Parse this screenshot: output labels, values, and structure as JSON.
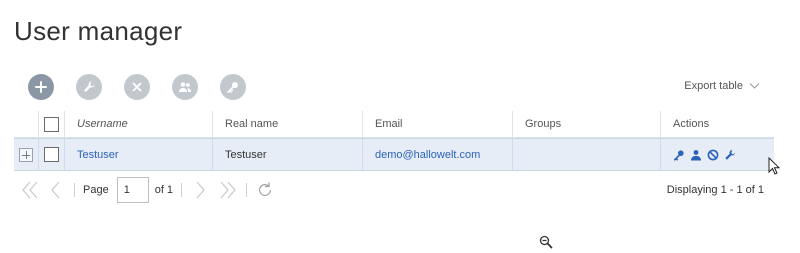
{
  "page": {
    "title": "User manager"
  },
  "toolbar": {
    "buttons": [
      {
        "name": "add-user-button",
        "icon": "plus-icon"
      },
      {
        "name": "edit-user-button",
        "icon": "wrench-icon"
      },
      {
        "name": "delete-user-button",
        "icon": "close-icon"
      },
      {
        "name": "assign-groups-button",
        "icon": "users-icon"
      },
      {
        "name": "set-password-button",
        "icon": "key-icon"
      }
    ],
    "export_label": "Export table"
  },
  "grid": {
    "columns": [
      "Username",
      "Real name",
      "Email",
      "Groups",
      "Actions"
    ],
    "rows": [
      {
        "username": "Testuser",
        "real_name": "Testuser",
        "email": "demo@hallowelt.com",
        "groups": ""
      }
    ],
    "row_actions": [
      "key-icon",
      "user-icon",
      "block-icon",
      "wrench-icon"
    ]
  },
  "pager": {
    "page_label": "Page",
    "current_page": "1",
    "of_label": "of 1",
    "displaying": "Displaying 1 - 1 of 1"
  },
  "colors": {
    "accent": "#2c63b8",
    "toolbar_button": "#c3c7ce",
    "toolbar_primary": "#8c97a6",
    "row_selected": "#e6edf7"
  }
}
